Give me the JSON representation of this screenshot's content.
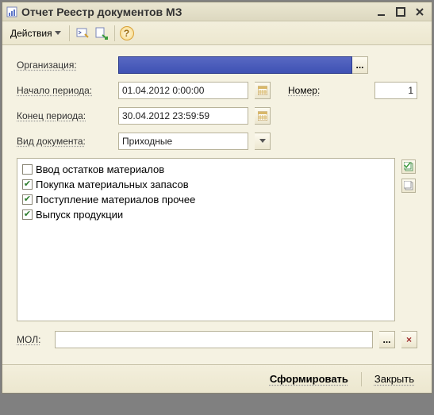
{
  "window": {
    "title": "Отчет  Реестр документов МЗ"
  },
  "toolbar": {
    "actions_label": "Действия"
  },
  "labels": {
    "org": "Организация:",
    "period_start": "Начало периода:",
    "period_end": "Конец периода:",
    "doc_type": "Вид документа:",
    "number": "Номер:",
    "mol": "МОЛ:"
  },
  "fields": {
    "org": "",
    "period_start": "01.04.2012  0:00:00",
    "period_end": "30.04.2012 23:59:59",
    "doc_type": "Приходные",
    "number": "1",
    "mol": ""
  },
  "checklist": [
    {
      "label": "Ввод остатков материалов",
      "checked": false
    },
    {
      "label": "Покупка материальных запасов",
      "checked": true
    },
    {
      "label": "Поступление материалов прочее",
      "checked": true
    },
    {
      "label": "Выпуск продукции",
      "checked": true
    }
  ],
  "footer": {
    "generate": "Сформировать",
    "close": "Закрыть"
  }
}
